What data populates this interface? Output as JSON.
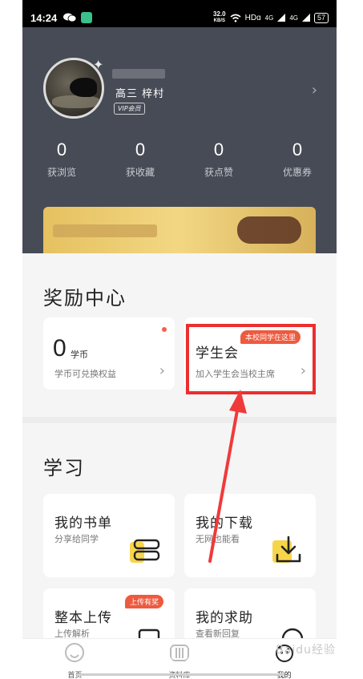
{
  "statusbar": {
    "time": "14:24",
    "speed_top": "32.0",
    "speed_bottom": "KB/S",
    "network": "HDɑ",
    "signal1": "4G",
    "signal2": "4G",
    "battery": "57"
  },
  "profile": {
    "username": "高三  梓村",
    "vip_label": "VIP会员",
    "stats": [
      {
        "value": "0",
        "label": "获浏览"
      },
      {
        "value": "0",
        "label": "获收藏"
      },
      {
        "value": "0",
        "label": "获点赞"
      },
      {
        "value": "0",
        "label": "优惠券"
      }
    ]
  },
  "rewards": {
    "title": "奖励中心",
    "coins": {
      "value": "0",
      "unit": "学币",
      "subtitle": "学币可兑换权益"
    },
    "student_union": {
      "title": "学生会",
      "subtitle": "加入学生会当校主席",
      "tag": "本校同学在这里"
    }
  },
  "study": {
    "title": "学习",
    "cards": [
      {
        "title": "我的书单",
        "subtitle": "分享给同学"
      },
      {
        "title": "我的下载",
        "subtitle": "无网也能看"
      },
      {
        "title": "整本上传",
        "subtitle": "上传解析",
        "tag": "上传有奖"
      },
      {
        "title": "我的求助",
        "subtitle": "查看新回复"
      }
    ]
  },
  "bottom_nav": [
    {
      "label": "首页"
    },
    {
      "label": "资料库"
    },
    {
      "label": "我的"
    }
  ],
  "watermark": "Baidu经验",
  "colors": {
    "header_bg": "#464b55",
    "accent_tag": "#ee5a3f",
    "highlight": "#ec2e2e",
    "icon_yellow": "#f7d54a"
  }
}
